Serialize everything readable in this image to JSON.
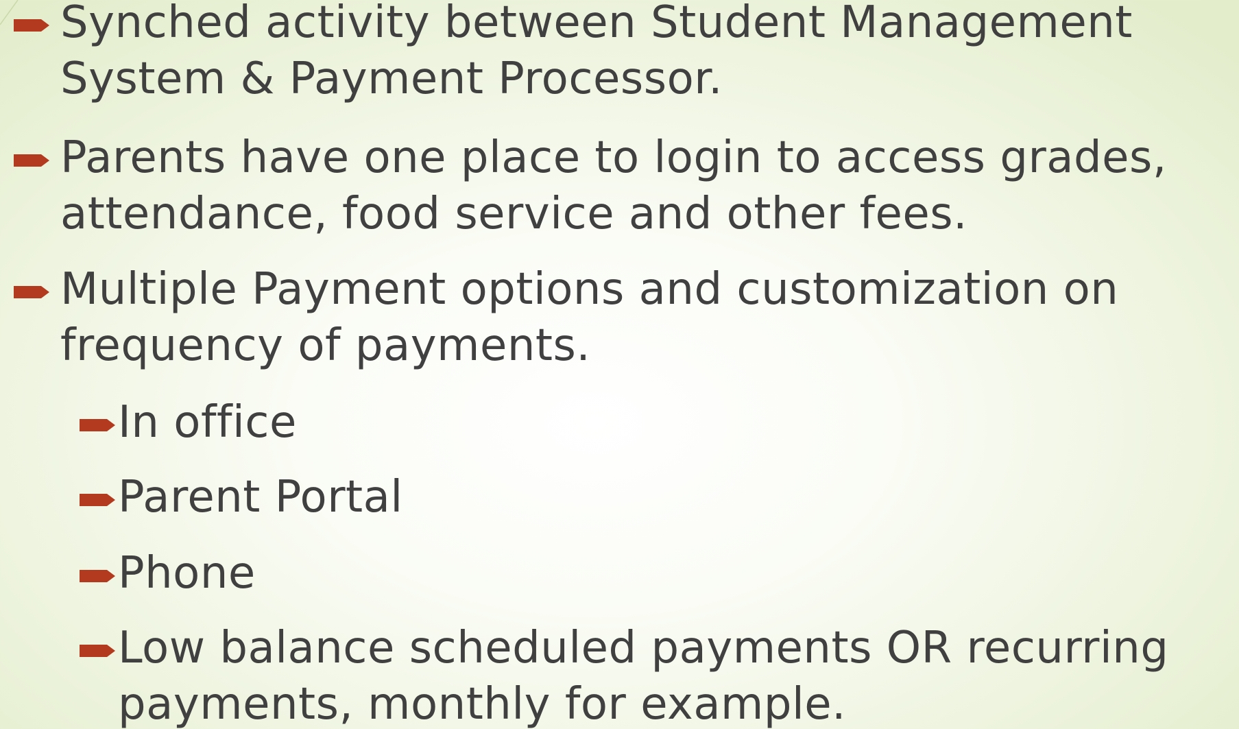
{
  "slide": {
    "bullets": [
      {
        "lines": [
          "Synched activity between Student Management",
          "System & Payment Processor."
        ]
      },
      {
        "lines": [
          "Parents have one place to login to access grades,",
          "attendance, food service and other fees."
        ]
      },
      {
        "lines": [
          "Multiple Payment options and customization on",
          "frequency of payments."
        ]
      }
    ],
    "sub_bullets": [
      {
        "lines": [
          "In office"
        ]
      },
      {
        "lines": [
          "Parent Portal"
        ]
      },
      {
        "lines": [
          "Phone"
        ]
      },
      {
        "lines": [
          "Low balance scheduled payments OR recurring",
          "payments, monthly for example."
        ]
      }
    ]
  },
  "colors": {
    "bullet_arrow": "#b33a1e",
    "text": "#404040",
    "background_center": "#ffffff",
    "background_edge": "#e3edcc"
  },
  "icons": {
    "bullet": "arrow-bullet-icon"
  }
}
